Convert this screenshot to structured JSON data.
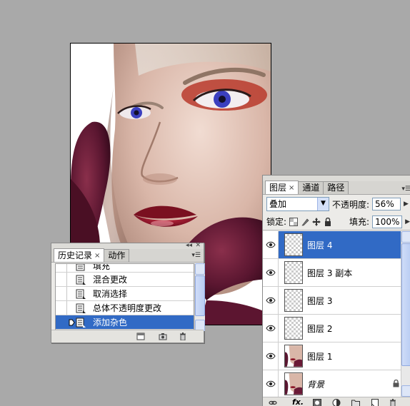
{
  "history_panel": {
    "tabs": [
      {
        "label": "历史记录",
        "active": true,
        "has_close": true
      },
      {
        "label": "动作",
        "active": false,
        "has_close": false
      }
    ],
    "close_symbol": "×",
    "items": [
      {
        "label": "填充",
        "icon": "history-state-icon",
        "selected": false
      },
      {
        "label": "混合更改",
        "icon": "history-state-icon",
        "selected": false
      },
      {
        "label": "取消选择",
        "icon": "history-state-icon",
        "selected": false
      },
      {
        "label": "总体不透明度更改",
        "icon": "history-state-icon",
        "selected": false
      },
      {
        "label": "添加杂色",
        "icon": "history-state-icon",
        "selected": true
      }
    ],
    "bottom_icons": [
      "new-document-from-state-icon",
      "camera-snapshot-icon",
      "trash-icon"
    ]
  },
  "layers_panel": {
    "tabs": [
      {
        "label": "图层",
        "active": true,
        "has_close": true
      },
      {
        "label": "通道",
        "active": false,
        "has_close": false
      },
      {
        "label": "路径",
        "active": false,
        "has_close": false
      }
    ],
    "close_symbol": "×",
    "blend_mode": "叠加",
    "opacity_label": "不透明度:",
    "opacity_value": "56%",
    "lock_label": "锁定:",
    "fill_label": "填充:",
    "fill_value": "100%",
    "layers": [
      {
        "name": "图层 4",
        "visible": true,
        "selected": true,
        "thumb": "transparent"
      },
      {
        "name": "图层 3 副本",
        "visible": true,
        "selected": false,
        "thumb": "transparent"
      },
      {
        "name": "图层 3",
        "visible": true,
        "selected": false,
        "thumb": "transparent"
      },
      {
        "name": "图层 2",
        "visible": true,
        "selected": false,
        "thumb": "transparent"
      },
      {
        "name": "图层 1",
        "visible": true,
        "selected": false,
        "thumb": "photo"
      },
      {
        "name": "背景",
        "visible": true,
        "selected": false,
        "thumb": "photo",
        "locked": true,
        "italic": true
      }
    ],
    "bottom_icons": [
      "link-layers-icon",
      "fx-icon",
      "layer-mask-icon",
      "adjustment-layer-icon",
      "folder-icon",
      "new-layer-icon",
      "trash-icon"
    ]
  },
  "colors": {
    "background": "#a9a9a9",
    "selection": "#316ac5",
    "panel": "#ecebe8"
  }
}
